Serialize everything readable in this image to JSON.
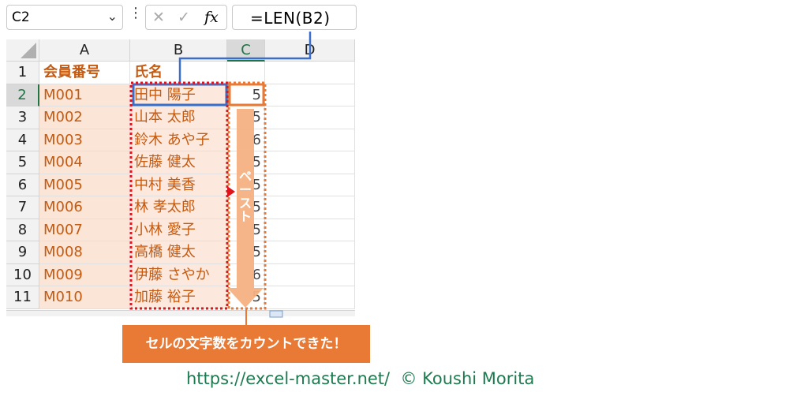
{
  "formula_bar": {
    "name_box": "C2",
    "name_box_chevron": "chevron-down-icon",
    "more_icon": "⋮",
    "cancel_icon": "✕",
    "enter_icon": "✓",
    "fx_label": "fx",
    "formula": "=LEN(B2)"
  },
  "columns": [
    "A",
    "B",
    "C",
    "D"
  ],
  "rows": [
    "1",
    "2",
    "3",
    "4",
    "5",
    "6",
    "7",
    "8",
    "9",
    "10",
    "11"
  ],
  "header_row": {
    "a": "会員番号",
    "b": "氏名"
  },
  "data_rows": [
    {
      "id": "M001",
      "name": "田中 陽子",
      "len": "5"
    },
    {
      "id": "M002",
      "name": "山本 太郎",
      "len": "5"
    },
    {
      "id": "M003",
      "name": "鈴木 あや子",
      "len": "6"
    },
    {
      "id": "M004",
      "name": "佐藤 健太",
      "len": "5"
    },
    {
      "id": "M005",
      "name": "中村 美香",
      "len": "5"
    },
    {
      "id": "M006",
      "name": "林 孝太郎",
      "len": "5"
    },
    {
      "id": "M007",
      "name": "小林 愛子",
      "len": "5"
    },
    {
      "id": "M008",
      "name": "高橋 健太",
      "len": "5"
    },
    {
      "id": "M009",
      "name": "伊藤 さやか",
      "len": "6"
    },
    {
      "id": "M010",
      "name": "加藤 裕子",
      "len": "5"
    }
  ],
  "paste_arrow_label": "ペースト",
  "callout": "セルの文字数をカウントできた！",
  "footer": "https://excel-master.net/  © Koushi Morita",
  "colors": {
    "accent_orange": "#e87a35",
    "highlight_blue": "#3b6ec8",
    "footer_green": "#1e7a4f",
    "dotted_red": "#e0141c"
  }
}
